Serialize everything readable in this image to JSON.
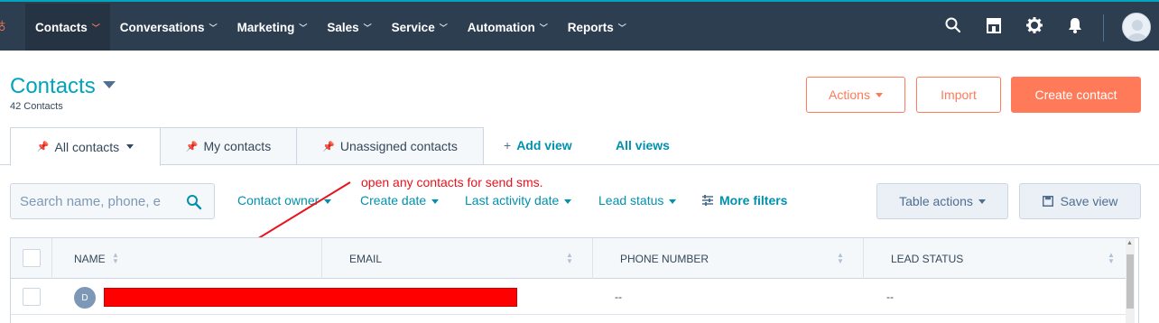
{
  "nav": {
    "items": [
      {
        "label": "Contacts"
      },
      {
        "label": "Conversations"
      },
      {
        "label": "Marketing"
      },
      {
        "label": "Sales"
      },
      {
        "label": "Service"
      },
      {
        "label": "Automation"
      },
      {
        "label": "Reports"
      }
    ],
    "icons": [
      "search-icon",
      "marketplace-icon",
      "gear-icon",
      "bell-icon",
      "avatar"
    ]
  },
  "header": {
    "title": "Contacts",
    "count": "42 Contacts",
    "actions_label": "Actions",
    "import_label": "Import",
    "create_label": "Create contact"
  },
  "tabs": {
    "items": [
      {
        "label": "All contacts"
      },
      {
        "label": "My contacts"
      },
      {
        "label": "Unassigned contacts"
      }
    ],
    "add_view": "Add view",
    "all_views": "All views"
  },
  "filters": {
    "search_placeholder": "Search name, phone, e",
    "contact_owner": "Contact owner",
    "create_date": "Create date",
    "last_activity": "Last activity date",
    "lead_status": "Lead status",
    "more_filters": "More filters",
    "table_actions": "Table actions",
    "save_view": "Save view"
  },
  "annotation": "open any contacts for send sms.",
  "table": {
    "columns": [
      "NAME",
      "EMAIL",
      "PHONE NUMBER",
      "LEAD STATUS"
    ],
    "rows": [
      {
        "avatar": "D",
        "email": "--",
        "phone": "--"
      }
    ]
  },
  "colors": {
    "nav_bg": "#2d3e50",
    "accent_orange": "#ff7a59",
    "link_teal": "#0091ae",
    "annotation_red": "#e8131c"
  }
}
